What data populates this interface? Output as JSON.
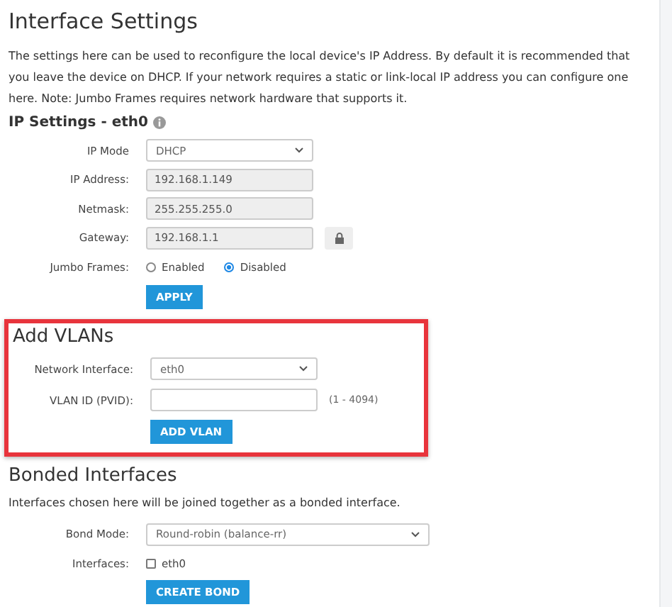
{
  "title": "Interface Settings",
  "description": "The settings here can be used to reconfigure the local device's IP Address. By default it is recommended that you leave the device on DHCP. If your network requires a static or link-local IP address you can configure one here. Note: Jumbo Frames requires network hardware that supports it.",
  "ip_settings": {
    "heading": "IP Settings - eth0",
    "rows": [
      {
        "kind": "select",
        "label": "IP Mode",
        "value": "DHCP"
      },
      {
        "kind": "readonly",
        "label": "IP Address:",
        "value": "192.168.1.149"
      },
      {
        "kind": "readonly",
        "label": "Netmask:",
        "value": "255.255.255.0"
      },
      {
        "kind": "readonly",
        "label": "Gateway:",
        "value": "192.168.1.1",
        "locked": true
      },
      {
        "kind": "radio",
        "label": "Jumbo Frames:",
        "options": [
          {
            "label": "Enabled",
            "selected": false
          },
          {
            "label": "Disabled",
            "selected": true
          }
        ]
      }
    ],
    "button": "APPLY"
  },
  "add_vlans": {
    "title": "Add VLANs",
    "highlighted": true,
    "rows": [
      {
        "kind": "select",
        "label": "Network Interface:",
        "value": "eth0"
      },
      {
        "kind": "input",
        "label": "VLAN ID (PVID):",
        "value": "",
        "hint": "(1 - 4094)"
      }
    ],
    "button": "ADD VLAN"
  },
  "bonded": {
    "title": "Bonded Interfaces",
    "description": "Interfaces chosen here will be joined together as a bonded interface.",
    "rows": [
      {
        "kind": "select",
        "label": "Bond Mode:",
        "value": "Round-robin (balance-rr)",
        "wide": true
      },
      {
        "kind": "checkbox",
        "label": "Interfaces:",
        "options": [
          {
            "label": "eth0",
            "checked": false
          }
        ]
      }
    ],
    "button": "CREATE BOND"
  }
}
